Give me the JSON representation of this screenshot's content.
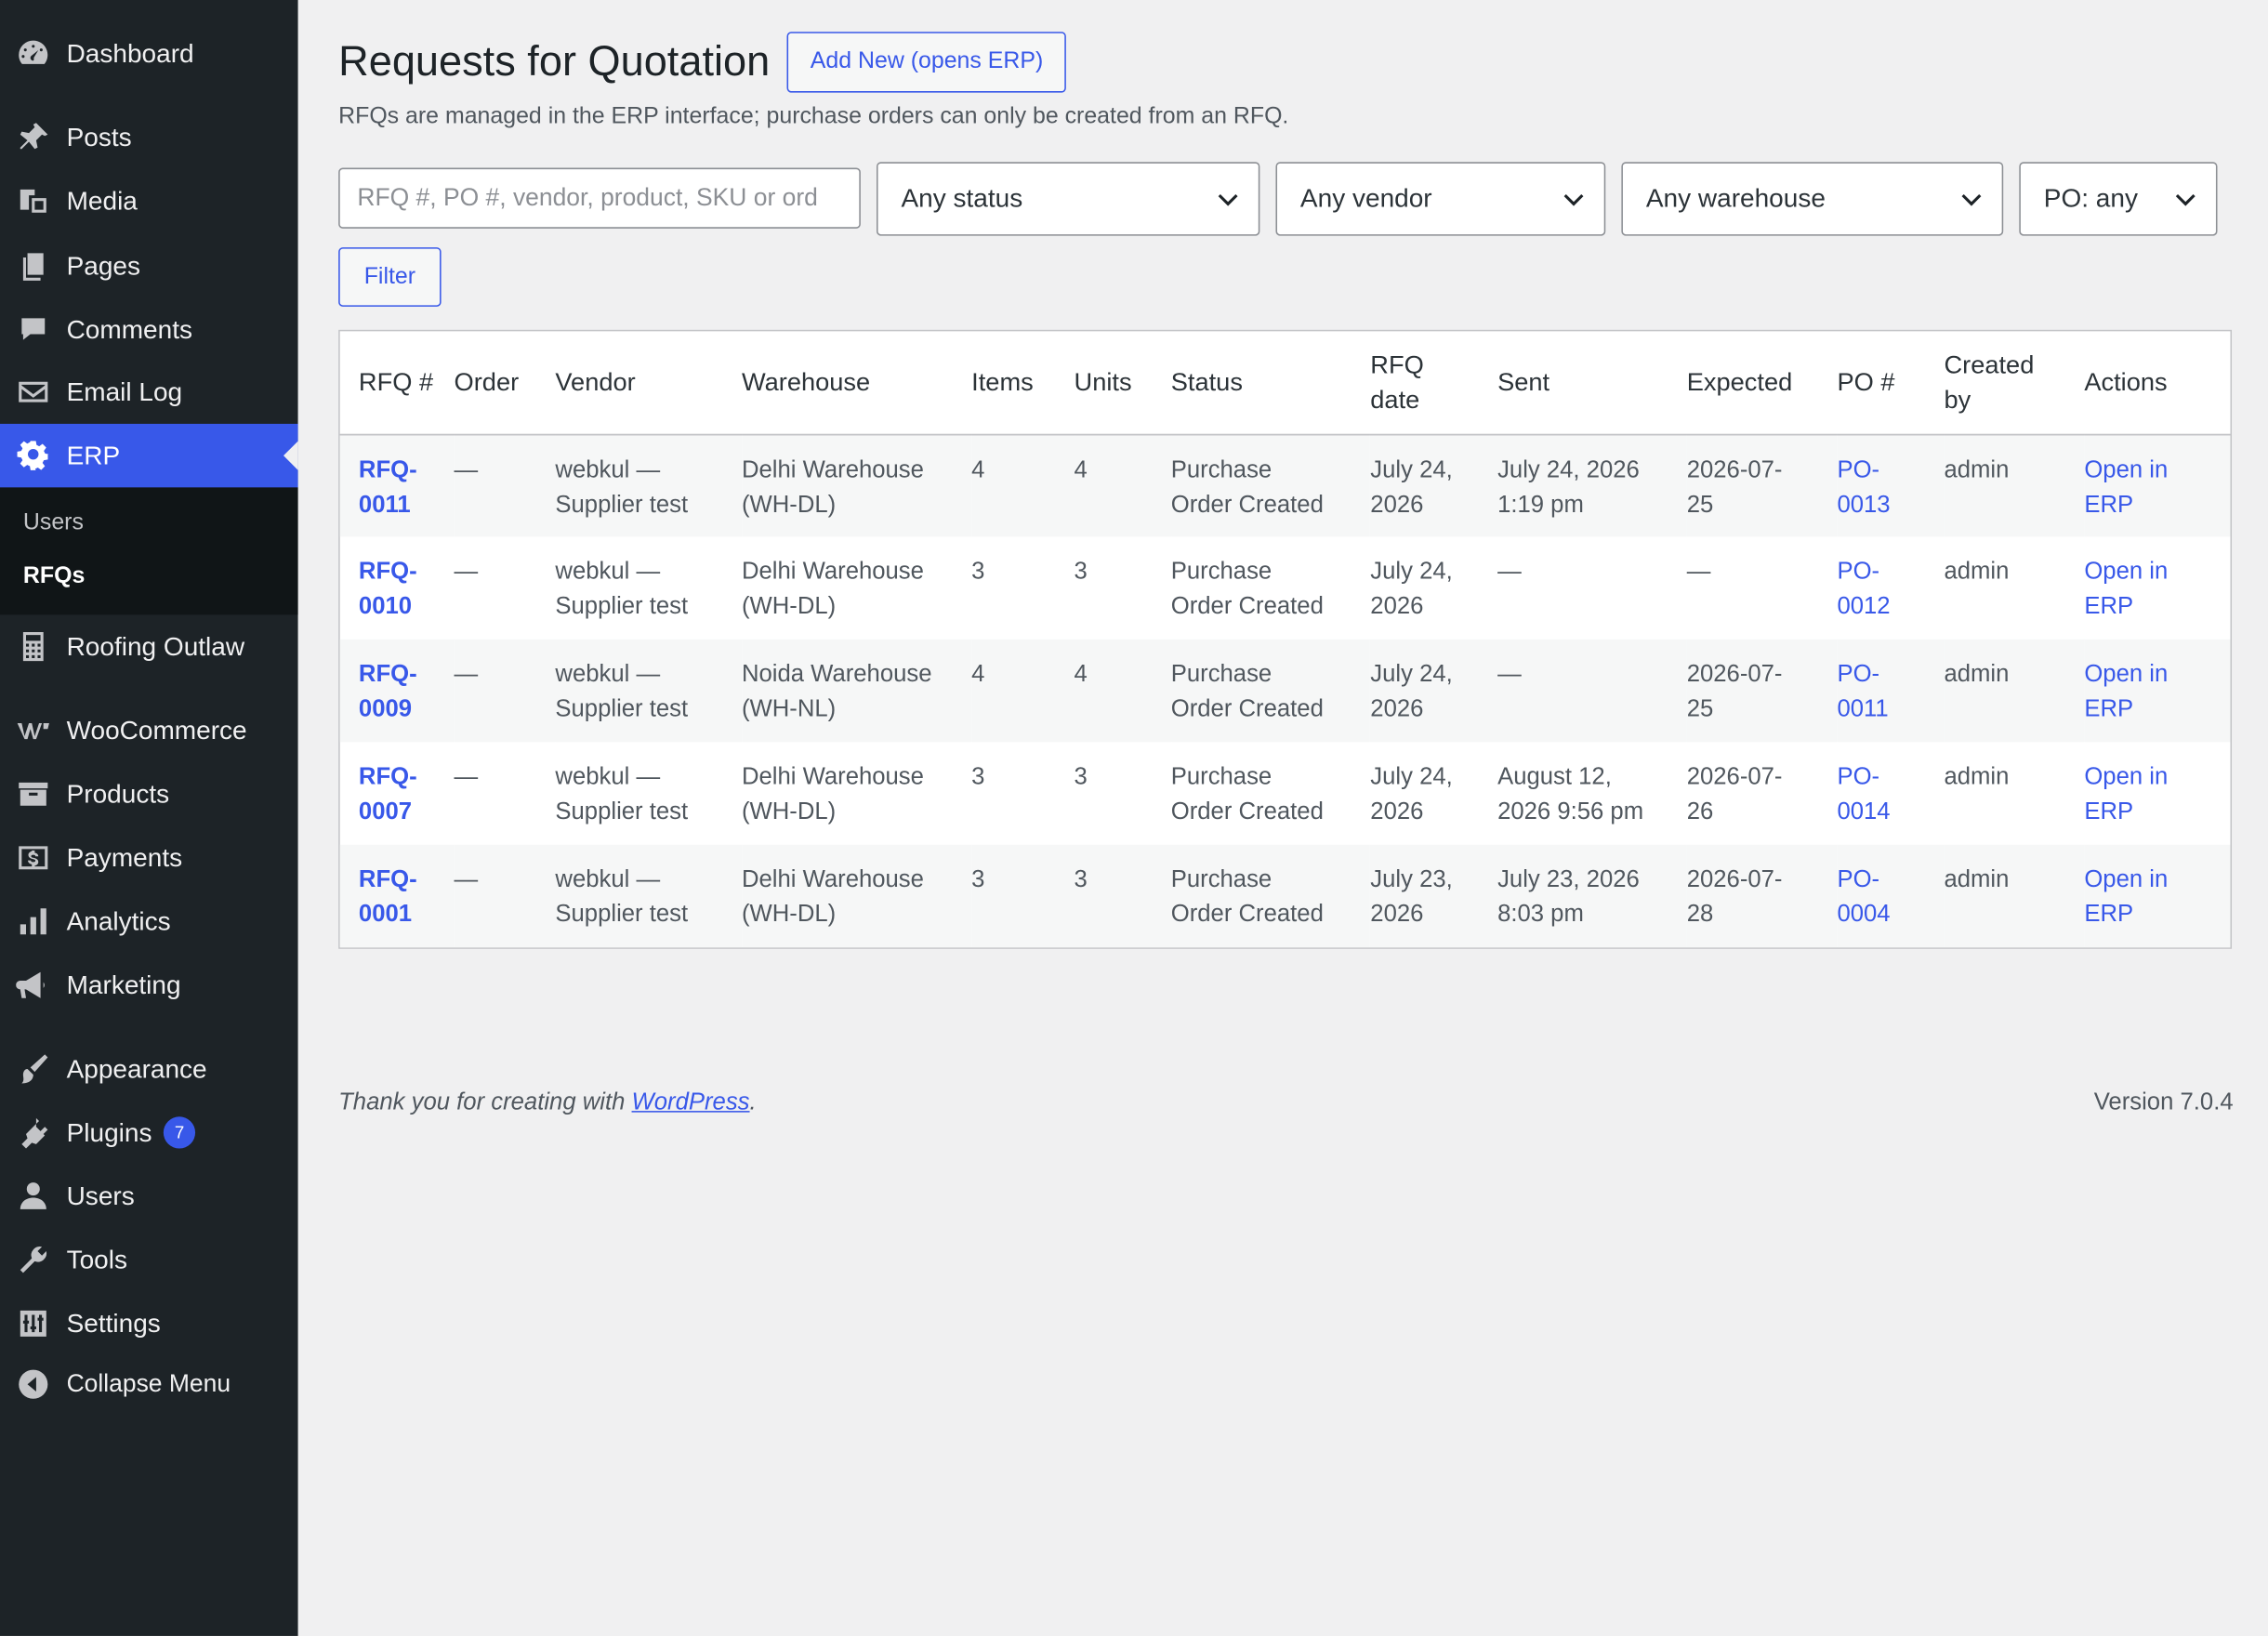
{
  "sidebar": {
    "items": [
      {
        "label": "Dashboard",
        "icon": "dashboard-icon"
      },
      {
        "label": "Posts",
        "icon": "pin-icon"
      },
      {
        "label": "Media",
        "icon": "media-icon"
      },
      {
        "label": "Pages",
        "icon": "pages-icon"
      },
      {
        "label": "Comments",
        "icon": "comment-icon"
      },
      {
        "label": "Email Log",
        "icon": "email-icon"
      },
      {
        "label": "ERP",
        "icon": "gear-icon"
      },
      {
        "label": "Roofing Outlaw",
        "icon": "calculator-icon"
      },
      {
        "label": "WooCommerce",
        "icon": "woo-icon"
      },
      {
        "label": "Products",
        "icon": "archive-icon"
      },
      {
        "label": "Payments",
        "icon": "dollar-icon"
      },
      {
        "label": "Analytics",
        "icon": "bar-chart-icon"
      },
      {
        "label": "Marketing",
        "icon": "megaphone-icon"
      },
      {
        "label": "Appearance",
        "icon": "brush-icon"
      },
      {
        "label": "Plugins",
        "icon": "plugin-icon",
        "badge": "7"
      },
      {
        "label": "Users",
        "icon": "user-icon"
      },
      {
        "label": "Tools",
        "icon": "wrench-icon"
      },
      {
        "label": "Settings",
        "icon": "sliders-icon"
      }
    ],
    "submenu": [
      {
        "label": "Users"
      },
      {
        "label": "RFQs"
      }
    ],
    "collapse_label": "Collapse Menu"
  },
  "page": {
    "title": "Requests for Quotation",
    "add_new_label": "Add New (opens ERP)",
    "description": "RFQs are managed in the ERP interface; purchase orders can only be created from an RFQ."
  },
  "filters": {
    "search_placeholder": "RFQ #, PO #, vendor, product, SKU or ord",
    "status": "Any status",
    "vendor": "Any vendor",
    "warehouse": "Any warehouse",
    "po": "PO: any",
    "filter_label": "Filter"
  },
  "table": {
    "headers": {
      "rfq": "RFQ #",
      "order": "Order",
      "vendor": "Vendor",
      "warehouse": "Warehouse",
      "items": "Items",
      "units": "Units",
      "status": "Status",
      "rfq_date_1": "RFQ",
      "rfq_date_2": "date",
      "sent": "Sent",
      "expected": "Expected",
      "po": "PO #",
      "created_1": "Created",
      "created_2": "by",
      "actions": "Actions"
    },
    "rows": [
      {
        "rfq_1": "RFQ-",
        "rfq_2": "0011",
        "order": "—",
        "vendor_1": "webkul —",
        "vendor_2": "Supplier test",
        "wh_1": "Delhi Warehouse",
        "wh_2": "(WH-DL)",
        "items": "4",
        "units": "4",
        "status_1": "Purchase",
        "status_2": "Order Created",
        "date_1": "July 24,",
        "date_2": "2026",
        "sent_1": "July 24, 2026",
        "sent_2": "1:19 pm",
        "exp_1": "2026-07-",
        "exp_2": "25",
        "po_1": "PO-",
        "po_2": "0013",
        "created": "admin",
        "act_1": "Open in",
        "act_2": "ERP"
      },
      {
        "rfq_1": "RFQ-",
        "rfq_2": "0010",
        "order": "—",
        "vendor_1": "webkul —",
        "vendor_2": "Supplier test",
        "wh_1": "Delhi Warehouse",
        "wh_2": "(WH-DL)",
        "items": "3",
        "units": "3",
        "status_1": "Purchase",
        "status_2": "Order Created",
        "date_1": "July 24,",
        "date_2": "2026",
        "sent_1": "—",
        "sent_2": "",
        "exp_1": "—",
        "exp_2": "",
        "po_1": "PO-",
        "po_2": "0012",
        "created": "admin",
        "act_1": "Open in",
        "act_2": "ERP"
      },
      {
        "rfq_1": "RFQ-",
        "rfq_2": "0009",
        "order": "—",
        "vendor_1": "webkul —",
        "vendor_2": "Supplier test",
        "wh_1": "Noida Warehouse",
        "wh_2": "(WH-NL)",
        "items": "4",
        "units": "4",
        "status_1": "Purchase",
        "status_2": "Order Created",
        "date_1": "July 24,",
        "date_2": "2026",
        "sent_1": "—",
        "sent_2": "",
        "exp_1": "2026-07-",
        "exp_2": "25",
        "po_1": "PO-",
        "po_2": "0011",
        "created": "admin",
        "act_1": "Open in",
        "act_2": "ERP"
      },
      {
        "rfq_1": "RFQ-",
        "rfq_2": "0007",
        "order": "—",
        "vendor_1": "webkul —",
        "vendor_2": "Supplier test",
        "wh_1": "Delhi Warehouse",
        "wh_2": "(WH-DL)",
        "items": "3",
        "units": "3",
        "status_1": "Purchase",
        "status_2": "Order Created",
        "date_1": "July 24,",
        "date_2": "2026",
        "sent_1": "August 12,",
        "sent_2": "2026 9:56 pm",
        "exp_1": "2026-07-",
        "exp_2": "26",
        "po_1": "PO-",
        "po_2": "0014",
        "created": "admin",
        "act_1": "Open in",
        "act_2": "ERP"
      },
      {
        "rfq_1": "RFQ-",
        "rfq_2": "0001",
        "order": "—",
        "vendor_1": "webkul —",
        "vendor_2": "Supplier test",
        "wh_1": "Delhi Warehouse",
        "wh_2": "(WH-DL)",
        "items": "3",
        "units": "3",
        "status_1": "Purchase",
        "status_2": "Order Created",
        "date_1": "July 23,",
        "date_2": "2026",
        "sent_1": "July 23, 2026",
        "sent_2": "8:03 pm",
        "exp_1": "2026-07-",
        "exp_2": "28",
        "po_1": "PO-",
        "po_2": "0004",
        "created": "admin",
        "act_1": "Open in",
        "act_2": "ERP"
      }
    ]
  },
  "footer": {
    "thanks_prefix": "Thank you for creating with ",
    "wordpress_link": "WordPress",
    "thanks_suffix": ".",
    "version": "Version 7.0.4"
  },
  "colors": {
    "sidebar_bg": "#1d2327",
    "accent": "#3858e9",
    "page_bg": "#f0f0f1"
  }
}
